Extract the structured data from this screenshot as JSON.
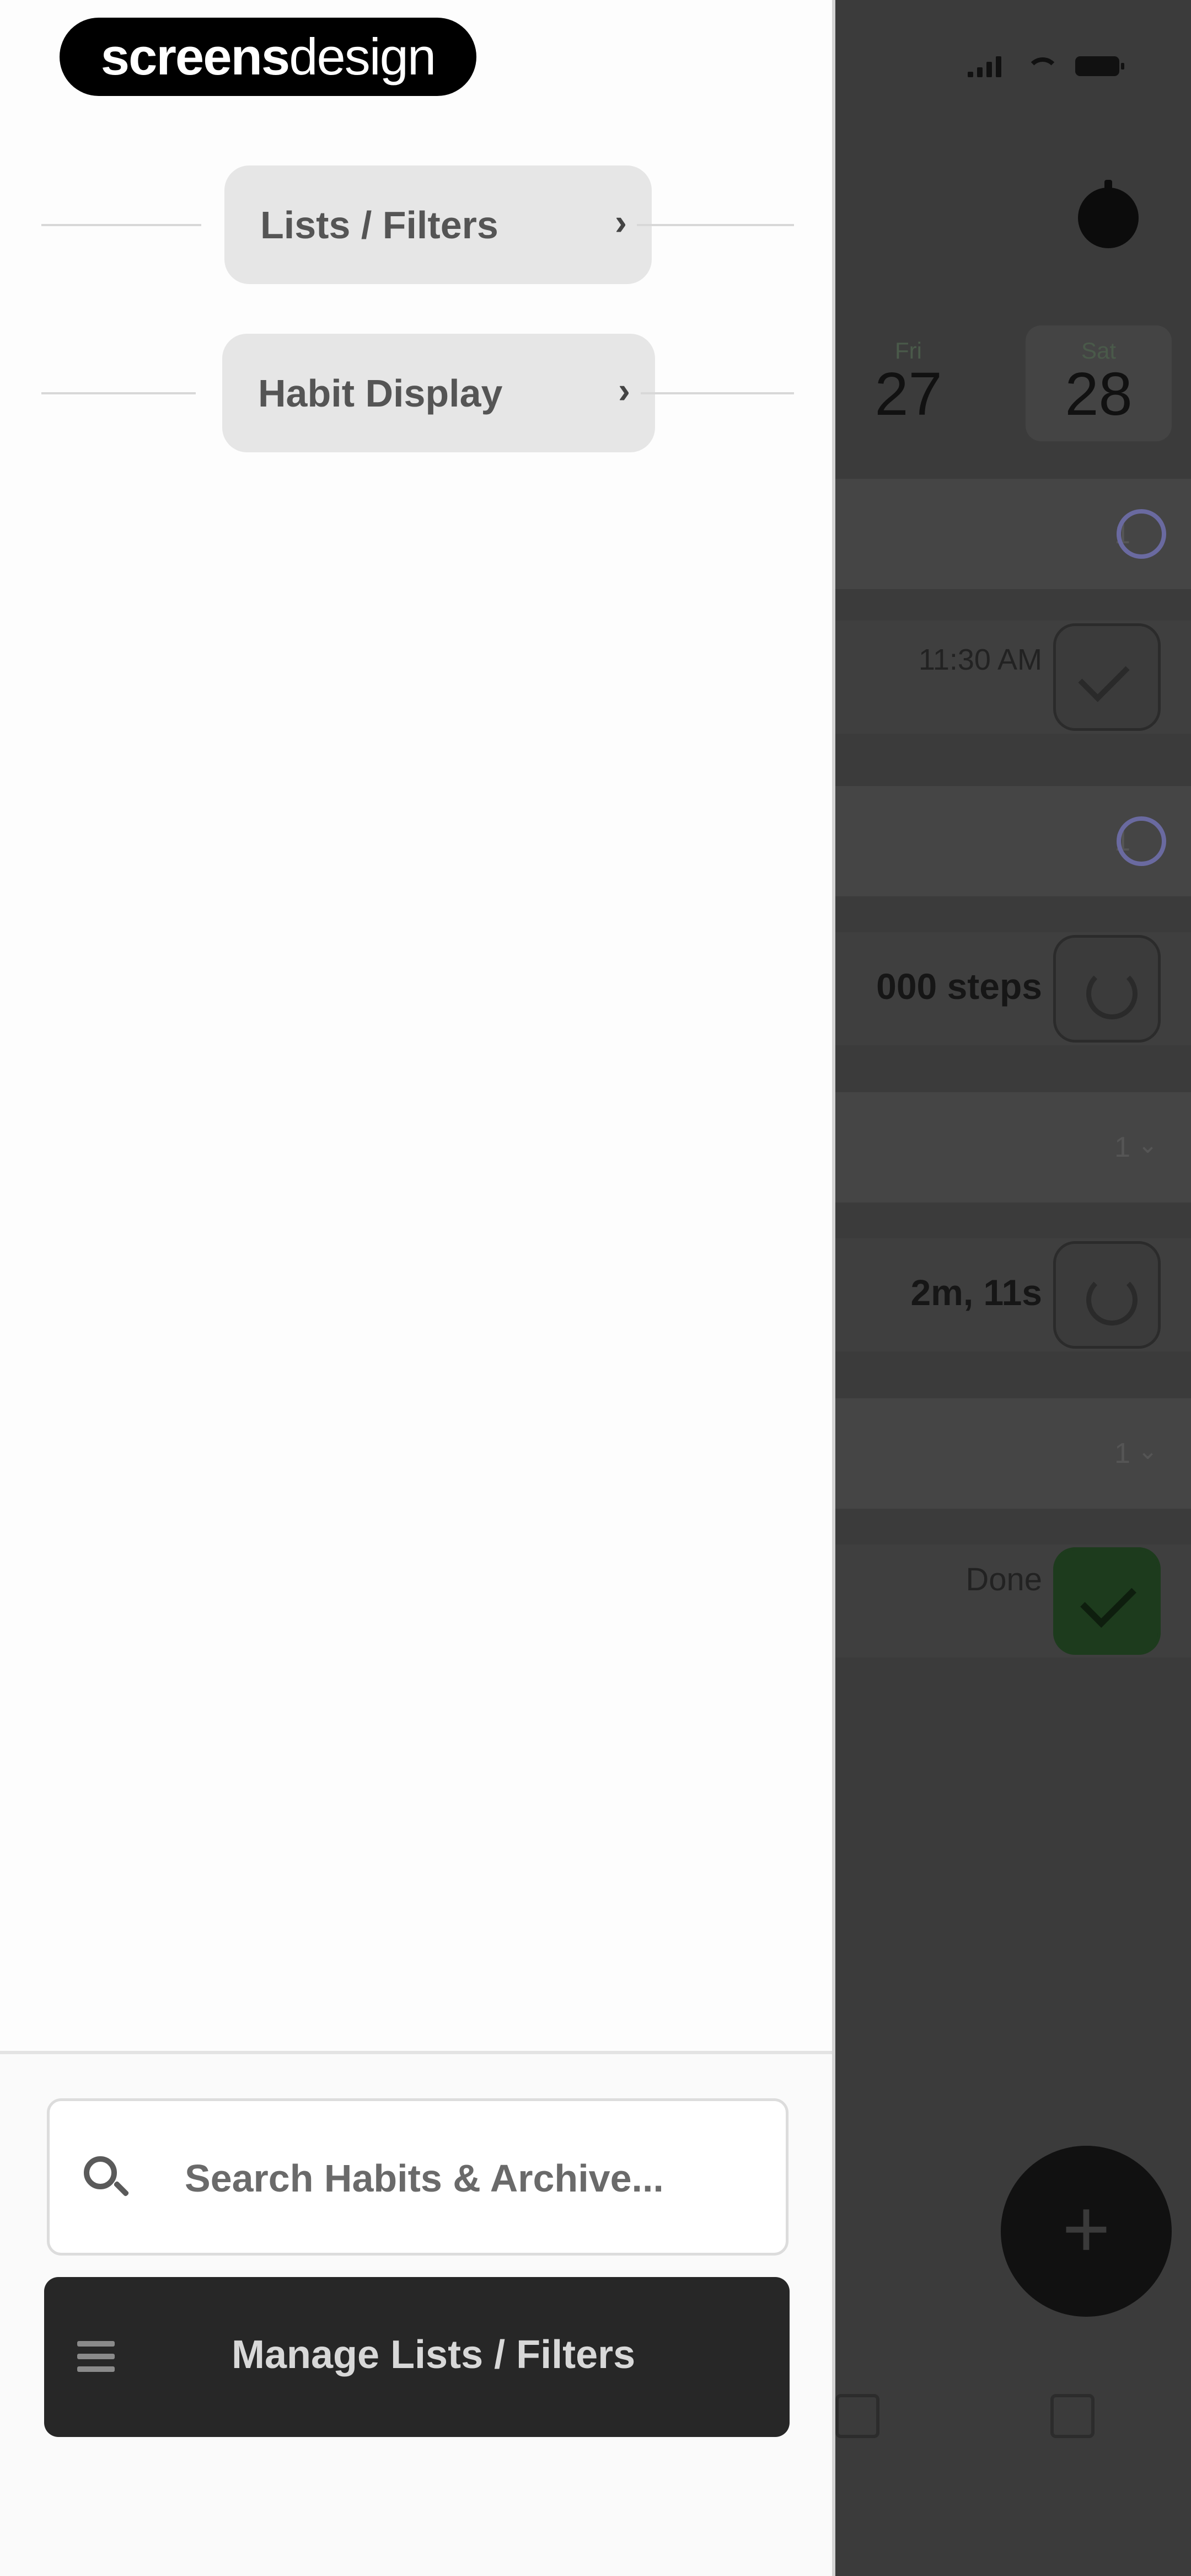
{
  "drawer": {
    "logo": {
      "bold": "screens",
      "light": "design"
    },
    "menu": [
      {
        "label": "Lists / Filters"
      },
      {
        "label": "Habit Display"
      }
    ],
    "search": {
      "placeholder": "Search Habits & Archive..."
    },
    "manage_button": {
      "label": "Manage Lists / Filters"
    }
  },
  "background": {
    "days": [
      {
        "name": "Fri",
        "num": "27"
      },
      {
        "name": "Sat",
        "num": "28"
      }
    ],
    "sections": [
      {
        "count": "1"
      },
      {
        "count": "1"
      },
      {
        "count": "1"
      },
      {
        "count": "1"
      }
    ],
    "habits": [
      {
        "text": "11:30 AM"
      },
      {
        "text": "000 steps"
      },
      {
        "text": "2m, 11s"
      },
      {
        "text": "Done"
      }
    ]
  },
  "icons": [
    "timer-icon",
    "search-icon",
    "list-icon",
    "check-icon",
    "repeat-icon",
    "plus-icon",
    "chevron-right-icon",
    "chevron-down-icon"
  ]
}
